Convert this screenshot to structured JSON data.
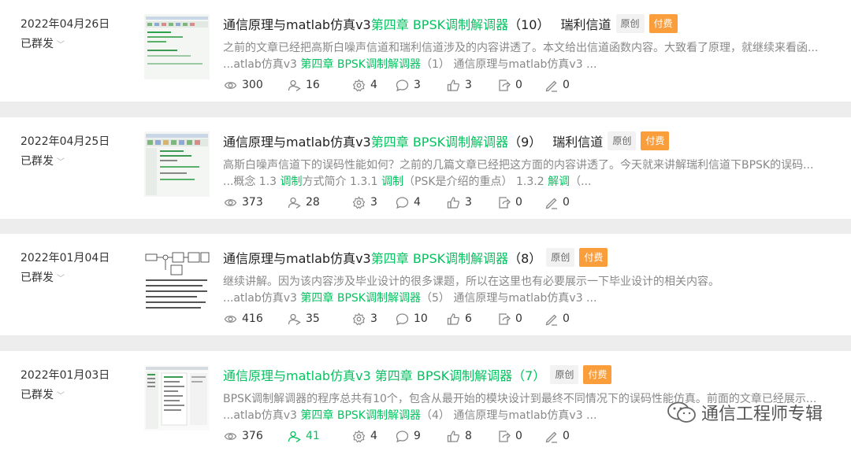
{
  "items": [
    {
      "date": "2022年04月26日",
      "status": "已群发",
      "title_parts": [
        "通信原理与matlab仿真v3 ",
        "第四章 BPSK调制解调器",
        "（10）",
        "瑞利信道"
      ],
      "title_hl": [
        false,
        true,
        false,
        false
      ],
      "tags": [
        "原创",
        "付费"
      ],
      "desc": "之前的文章已经把高斯白噪声信道和瑞利信道涉及的内容讲透了。本文给出信道函数内容。大致看了原理，就继续来看函...",
      "excerpt_parts": [
        "...atlab仿真v3 ",
        "第四章 BPSK调制解调器",
        "（1） 通信原理与matlab仿真v3 ..."
      ],
      "excerpt_hl": [
        false,
        true,
        false
      ],
      "stats": [
        "300",
        "16",
        "4",
        "3",
        "3",
        "0",
        "0"
      ]
    },
    {
      "date": "2022年04月25日",
      "status": "已群发",
      "title_parts": [
        "通信原理与matlab仿真v3 ",
        "第四章 BPSK调制解调器",
        "（9）",
        "瑞利信道"
      ],
      "title_hl": [
        false,
        true,
        false,
        false
      ],
      "tags": [
        "原创",
        "付费"
      ],
      "desc": "高斯白噪声信道下的误码性能如何？之前的几篇文章已经把这方面的内容讲透了。今天就来讲解瑞利信道下BPSK的误码...",
      "excerpt_parts": [
        "...概念 1.3 ",
        "调制",
        "方式简介 1.3.1 ",
        "调制",
        "（PSK是介绍的重点） 1.3.2 ",
        "解调",
        "（..."
      ],
      "excerpt_hl": [
        false,
        true,
        false,
        true,
        false,
        true,
        false
      ],
      "stats": [
        "373",
        "28",
        "3",
        "4",
        "3",
        "0",
        "0"
      ]
    },
    {
      "date": "2022年01月04日",
      "status": "已群发",
      "title_parts": [
        "通信原理与matlab仿真v3 ",
        "第四章 BPSK调制解调器",
        "（8）"
      ],
      "title_hl": [
        false,
        true,
        false
      ],
      "tags": [
        "原创",
        "付费"
      ],
      "desc": "继续讲解。因为该内容涉及毕业设计的很多课题，所以在这里也有必要展示一下毕业设计的相关内容。",
      "excerpt_parts": [
        "...atlab仿真v3 ",
        "第四章 BPSK调制解调器",
        "（5） 通信原理与matlab仿真v3 ..."
      ],
      "excerpt_hl": [
        false,
        true,
        false
      ],
      "stats": [
        "416",
        "35",
        "3",
        "10",
        "6",
        "0",
        "0"
      ]
    },
    {
      "date": "2022年01月03日",
      "status": "已群发",
      "title_parts": [
        "通信原理与matlab仿真v3 第四章 BPSK调制解调器（7）"
      ],
      "title_hl": [
        true
      ],
      "tags": [
        "原创",
        "付费"
      ],
      "desc": "BPSK调制解调器的程序总共有10个，包含从最开始的模块设计到最终不同情况下的误码性能仿真。前面的文章已经展示...",
      "excerpt_parts": [
        "...atlab仿真v3 ",
        "第四章 BPSK调制解调器",
        "（4） 通信原理与matlab仿真v3 ..."
      ],
      "excerpt_hl": [
        false,
        true,
        false
      ],
      "stats": [
        "376",
        "41",
        "4",
        "9",
        "8",
        "0",
        "0"
      ],
      "stats_hl": [
        false,
        true,
        false,
        false,
        false,
        false,
        false
      ]
    }
  ],
  "stat_icons": [
    "eye-icon",
    "user-share-icon",
    "gear-icon",
    "comment-icon",
    "thumbs-up-icon",
    "forward-icon",
    "pencil-icon"
  ],
  "watermark": "通信工程师专辑",
  "accent_color": "#07c160",
  "paid_color": "#fa9d3b"
}
